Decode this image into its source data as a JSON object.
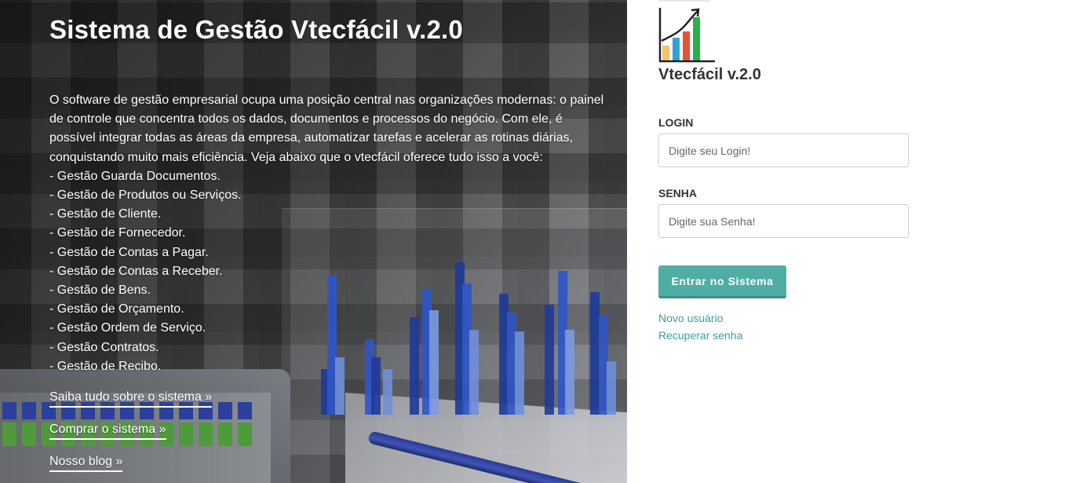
{
  "hero": {
    "title": "Sistema de Gestão Vtecfácil v.2.0",
    "intro": "O software de gestão empresarial ocupa uma posição central nas organizações modernas: o painel de controle que concentra todos os dados, documentos e processos do negócio. Com ele, é possível integrar todas as áreas da empresa, automatizar tarefas e acelerar as rotinas diárias, conquistando muito mais eficiência. Veja abaixo que o vtecfácil oferece tudo isso a você:",
    "features": [
      "- Gestão Guarda Documentos.",
      "- Gestão de Produtos ou Serviços.",
      "- Gestão de Cliente.",
      "- Gestão de Fornecedor.",
      "- Gestão de Contas a Pagar.",
      "- Gestão de Contas a Receber.",
      "- Gestão de Bens.",
      "- Gestão de Orçamento.",
      "- Gestão Ordem de Serviço.",
      "- Gestão Contratos.",
      "- Gestão de Recibo."
    ],
    "links": {
      "about": "Saiba tudo sobre o sistema »",
      "buy": "Comprar o sistema »",
      "blog": "Nosso blog »"
    }
  },
  "login": {
    "brand": "Vtecfácil v.2.0",
    "login_label": "LOGIN",
    "login_placeholder": "Digite seu Login!",
    "password_label": "SENHA",
    "password_placeholder": "Digite sua Senha!",
    "submit_label": "Entrar no Sistema",
    "new_user_link": "Novo usuário",
    "recover_link": "Recuperar senha"
  },
  "colors": {
    "accent": "#4fada4",
    "link": "#3a9fa0",
    "logo_bars": [
      "#f6c26b",
      "#2fa3d6",
      "#e8503a",
      "#28b14a"
    ]
  },
  "icons": {
    "logo": "growth-chart-icon"
  }
}
